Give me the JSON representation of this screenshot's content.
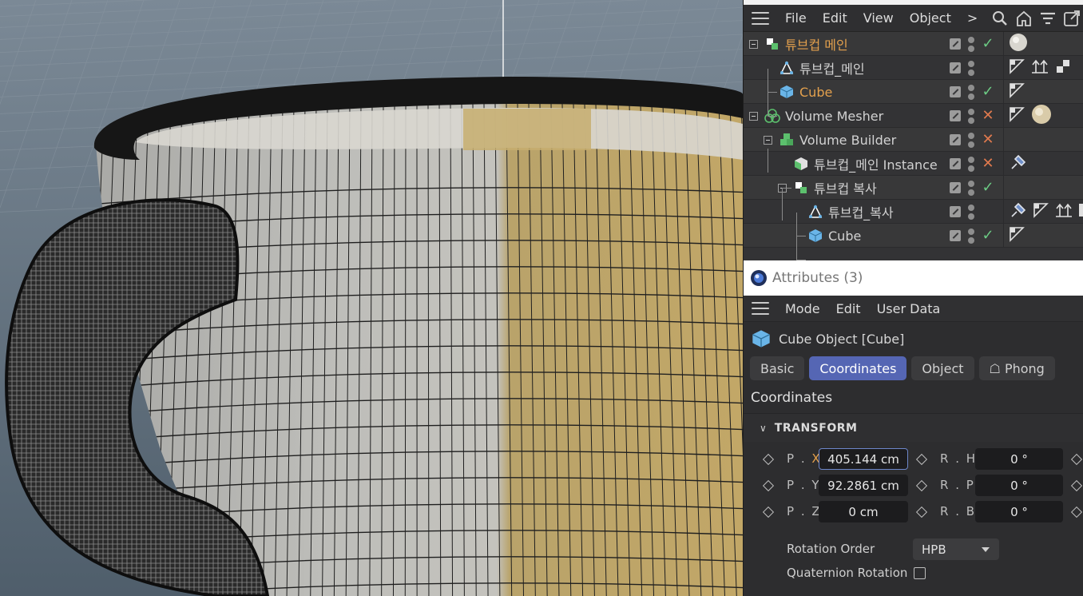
{
  "object_manager": {
    "menu": [
      "File",
      "Edit",
      "View",
      "Object",
      ">"
    ],
    "tools": [
      "search-icon",
      "home-icon",
      "filter-icon",
      "external-link-icon"
    ],
    "rows": [
      {
        "name": "튜브컵 메인",
        "color": "orange",
        "icon": "null-group-icon",
        "state": "check",
        "tags": [
          "material-sphere-icon"
        ]
      },
      {
        "name": "튜브컵_메인",
        "color": "default",
        "icon": "spline-point-icon",
        "state": "none",
        "tags": [
          "phong-tag-icon",
          "align-tag-icon",
          "uv-tag-icon"
        ]
      },
      {
        "name": "Cube",
        "color": "orange",
        "icon": "cube-icon",
        "state": "check",
        "tags": [
          "phong-tag-icon"
        ]
      },
      {
        "name": "Volume Mesher",
        "color": "default",
        "icon": "volume-mesher-icon",
        "state": "cross",
        "tags": [
          "phong-tag-icon",
          "material-sphere-icon"
        ]
      },
      {
        "name": "Volume Builder",
        "color": "default",
        "icon": "volume-builder-icon",
        "state": "cross",
        "tags": []
      },
      {
        "name": "튜브컵_메인 Instance",
        "color": "default",
        "icon": "instance-icon",
        "state": "cross",
        "tags": [
          "pin-tag-icon"
        ]
      },
      {
        "name": "튜브컵 복사",
        "color": "default",
        "icon": "null-group-icon",
        "state": "check",
        "tags": []
      },
      {
        "name": "튜브컵_복사",
        "color": "default",
        "icon": "spline-point-icon",
        "state": "none",
        "tags": [
          "pin-tag-icon",
          "phong-tag-icon",
          "align-tag-icon",
          "checker-tag-icon"
        ]
      },
      {
        "name": "Cube",
        "color": "default",
        "icon": "cube-icon",
        "state": "check",
        "tags": [
          "phong-tag-icon"
        ]
      }
    ]
  },
  "attributes": {
    "title": "Attributes (3)",
    "menu": [
      "Mode",
      "Edit",
      "User Data"
    ],
    "object_title": "Cube Object [Cube]",
    "tabs": [
      {
        "label": "Basic",
        "active": false
      },
      {
        "label": "Coordinates",
        "active": true
      },
      {
        "label": "Object",
        "active": false
      },
      {
        "label": "☖ Phong",
        "active": false
      }
    ],
    "section": "Coordinates",
    "group": "TRANSFORM",
    "position": [
      {
        "label": "P . ",
        "axis": "X",
        "value": "405.144 cm"
      },
      {
        "label": "P . Y",
        "axis": "",
        "value": "92.2861 cm"
      },
      {
        "label": "P . Z",
        "axis": "",
        "value": "0 cm"
      }
    ],
    "rotation": [
      {
        "label": "R . H",
        "value": "0 °"
      },
      {
        "label": "R . P",
        "value": "0 °"
      },
      {
        "label": "R . B",
        "value": "0 °"
      }
    ],
    "rotation_order_label": "Rotation Order",
    "rotation_order_value": "HPB",
    "quaternion_label": "Quaternion Rotation",
    "quaternion_checked": false
  },
  "colors": {
    "accent": "#5566b4",
    "orange": "#e3a04d",
    "check": "#6ccb84",
    "cross": "#e07a4e"
  }
}
